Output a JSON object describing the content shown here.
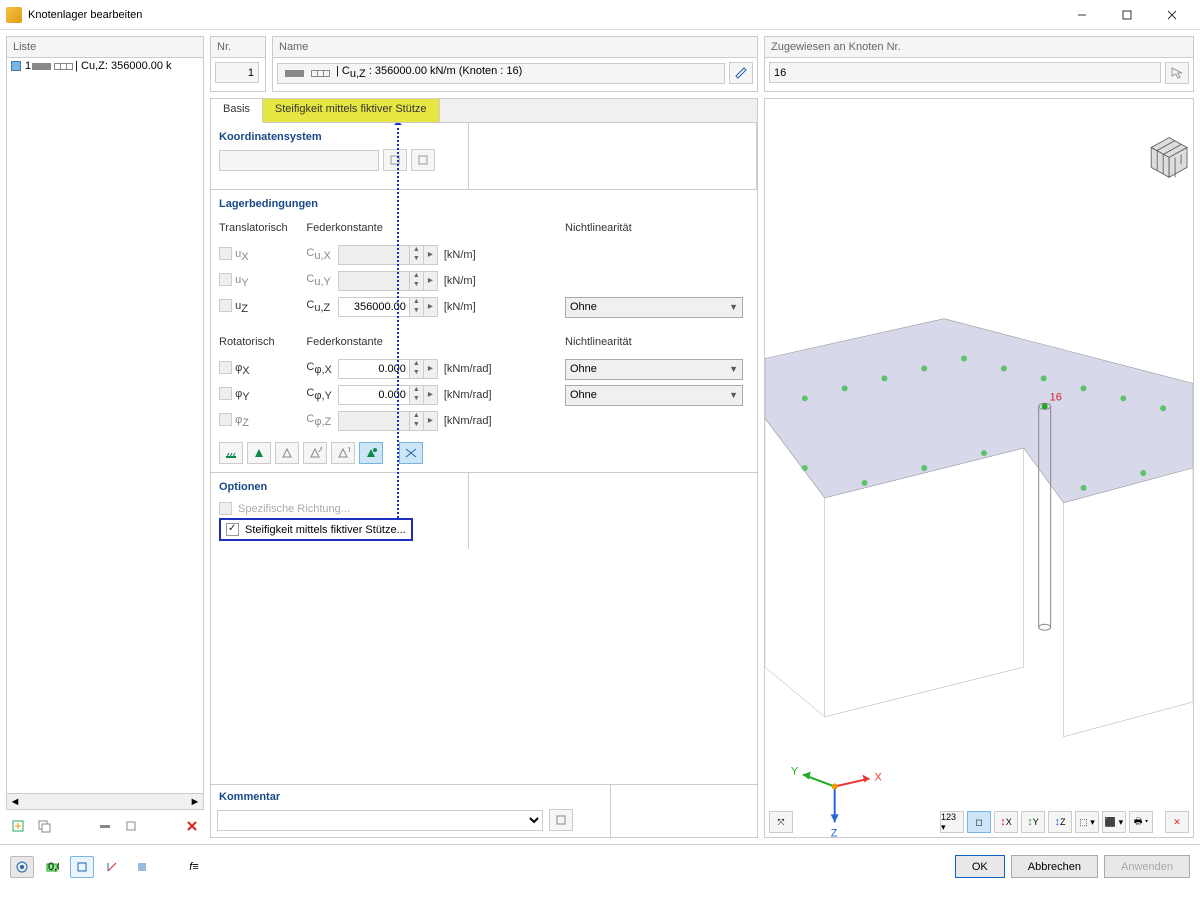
{
  "window": {
    "title": "Knotenlager bearbeiten"
  },
  "list": {
    "header": "Liste",
    "items": [
      {
        "num": "1",
        "desc": "| C",
        "sub": "u,Z",
        "desc2": " : 356000.00 k"
      }
    ]
  },
  "nr": {
    "header": "Nr.",
    "value": "1"
  },
  "name": {
    "header": "Name",
    "prefix": "| C",
    "sub": "u,Z",
    "value": " : 356000.00 kN/m (Knoten : 16)"
  },
  "assign": {
    "header": "Zugewiesen an Knoten Nr.",
    "value": "16"
  },
  "tabs": {
    "basis": "Basis",
    "stiffness": "Steifigkeit mittels fiktiver Stütze"
  },
  "coord": {
    "title": "Koordinatensystem"
  },
  "support": {
    "title": "Lagerbedingungen",
    "trans_hdr": "Translatorisch",
    "spring_hdr": "Federkonstante",
    "nonlin_hdr": "Nichtlinearität",
    "rot_hdr": "Rotatorisch",
    "rows_t": [
      {
        "lab": "uX",
        "sp": "Cu,X",
        "val": "",
        "unit": "[kN/m]",
        "nl": "",
        "en": false
      },
      {
        "lab": "uY",
        "sp": "Cu,Y",
        "val": "",
        "unit": "[kN/m]",
        "nl": "",
        "en": false
      },
      {
        "lab": "uZ",
        "sp": "Cu,Z",
        "val": "356000.00",
        "unit": "[kN/m]",
        "nl": "Ohne",
        "en": true
      }
    ],
    "rows_r": [
      {
        "lab": "φX",
        "sp": "Cφ,X",
        "val": "0.000",
        "unit": "[kNm/rad]",
        "nl": "Ohne",
        "en": true
      },
      {
        "lab": "φY",
        "sp": "Cφ,Y",
        "val": "0.000",
        "unit": "[kNm/rad]",
        "nl": "Ohne",
        "en": true
      },
      {
        "lab": "φZ",
        "sp": "Cφ,Z",
        "val": "",
        "unit": "[kNm/rad]",
        "nl": "",
        "en": false
      }
    ]
  },
  "options": {
    "title": "Optionen",
    "specific": "Spezifische Richtung...",
    "stiffness": "Steifigkeit mittels fiktiver Stütze..."
  },
  "comment": {
    "title": "Kommentar"
  },
  "buttons": {
    "ok": "OK",
    "cancel": "Abbrechen",
    "apply": "Anwenden"
  },
  "preview": {
    "node_label": "16",
    "axes": {
      "x": "X",
      "y": "Y",
      "z": "Z"
    }
  }
}
